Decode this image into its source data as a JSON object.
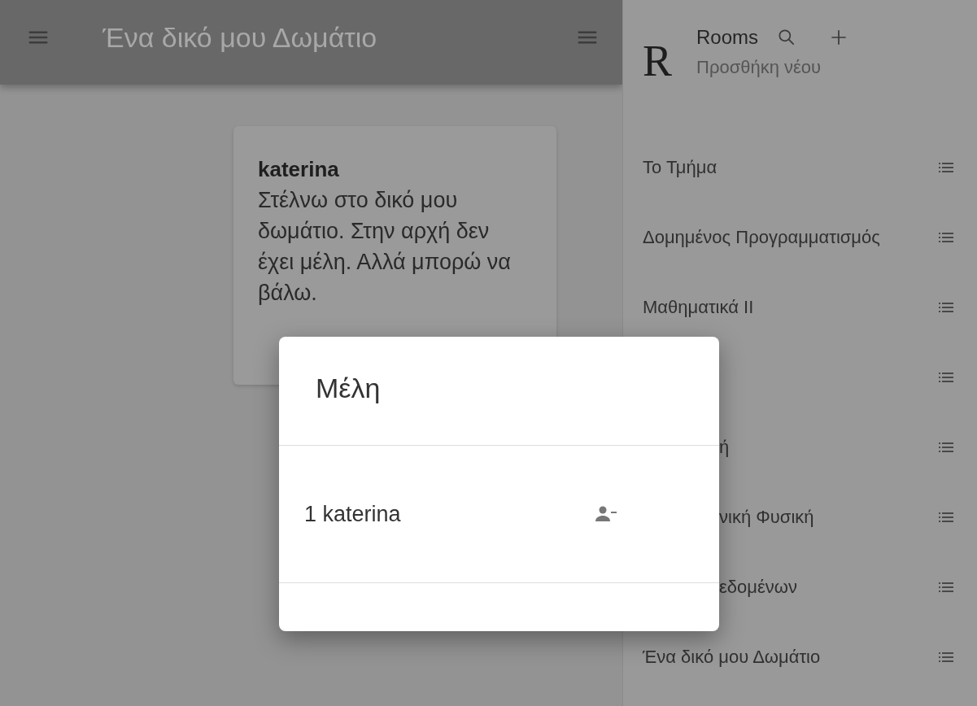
{
  "header": {
    "title": "Ένα δικό μου Δωμάτιο"
  },
  "message": {
    "author": "katerina",
    "text": "Στέλνω στο δικό μου δωμάτιο. Στην αρχή δεν έχει μέλη. Αλλά μπορώ να βάλω."
  },
  "sidebar": {
    "logo": "R",
    "title": "Rooms",
    "subtitle": "Προσθήκη νέου",
    "items": [
      {
        "kind": "room",
        "label": "Το Τμήμα",
        "cut": false
      },
      {
        "kind": "room",
        "label": "Δομημένος Προγραμματισμός",
        "cut": false
      },
      {
        "kind": "room",
        "label": "Μαθηματικά ΙΙ",
        "cut": false
      },
      {
        "kind": "covered"
      },
      {
        "kind": "room",
        "label": "ή",
        "cut": true
      },
      {
        "kind": "room",
        "label": "νική Φυσική",
        "cut": true
      },
      {
        "kind": "room",
        "label": "εδομένων",
        "cut": true
      },
      {
        "kind": "room",
        "label": "Ένα δικό μου Δωμάτιο",
        "cut": false
      }
    ]
  },
  "dialog": {
    "title": "Μέλη",
    "members": [
      {
        "number": "1",
        "name": "katerina"
      }
    ]
  }
}
